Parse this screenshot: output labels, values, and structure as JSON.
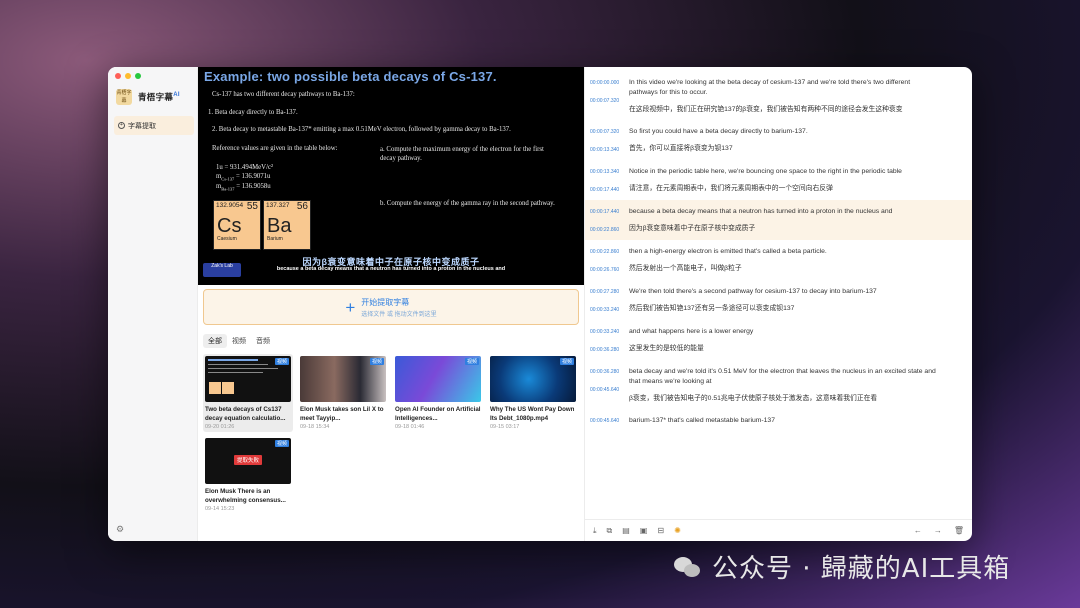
{
  "colors": {
    "accent": "#2f7fe0",
    "highlight": "#fcf3e6",
    "nav_active": "#faeedd",
    "timestamp": "#3a7fd0"
  },
  "app": {
    "name": "青梧字幕",
    "name_sup": "AI",
    "logo_text": "青梧字幕"
  },
  "sidebar": {
    "items": [
      {
        "label": "字幕提取",
        "icon": "plus-circle-icon"
      }
    ],
    "settings_icon": "gear-icon"
  },
  "video": {
    "title": "Example:  two possible beta decays of Cs-137.",
    "intro": "Cs-137 has two different decay pathways to Ba-137:",
    "item1": "1.   Beta decay directly to Ba-137.",
    "item2": "2.   Beta decay to metastable Ba-137* emitting a max 0.51MeV electron, followed by gamma decay to Ba-137.",
    "ref": "Reference values are given in the table below:",
    "qa": "a.   Compute the maximum energy of the electron for the first decay pathway.",
    "qb": "b.   Compute the energy of the gamma ray in the second pathway.",
    "v1": "1u = 931.494MeV/c²",
    "v2": "m",
    "v2s": "Cs-137",
    "v2v": " = 136.9071u",
    "v3": "m",
    "v3s": "Ba-137",
    "v3v": " = 136.9058u",
    "cs": {
      "mass": "132.9054",
      "num": "55",
      "sym": "Cs",
      "name": "Caesium"
    },
    "ba": {
      "mass": "137.327",
      "num": "56",
      "sym": "Ba",
      "name": "Barium"
    },
    "channel": "Zak's Lab",
    "subtitle_zh": "因为β衰变意味着中子在原子核中变成质子",
    "subtitle_en": "because a beta decay means that a neutron has turned into a proton in the nucleus and"
  },
  "upload": {
    "title": "开始提取字幕",
    "hint": "选择文件 或 拖动文件到这里"
  },
  "tabs": [
    {
      "label": "全部"
    },
    {
      "label": "视频"
    },
    {
      "label": "音频"
    }
  ],
  "media": [
    {
      "title": "Two beta decays of Cs137 decay equation calculatio...",
      "date": "09-20 01:26",
      "badge": "视频"
    },
    {
      "title": "Elon Musk takes son Lil X to meet Tayyip...",
      "date": "09-18 15:34",
      "badge": "视频"
    },
    {
      "title": "Open AI Founder on Artificial Intelligences...",
      "date": "09-18 01:46",
      "badge": "视频"
    },
    {
      "title": "Why The US Wont Pay Down Its Debt_1080p.mp4",
      "date": "09-15 03:17",
      "badge": "视频"
    },
    {
      "title": "Elon Musk There is an overwhelming consensus...",
      "date": "09-14 15:23",
      "badge": "视频",
      "status": "提取失败"
    }
  ],
  "subtitles": [
    {
      "start": "00:00:00.000",
      "end": "00:00:07.320",
      "en": "In this video we're looking at the beta decay of cesium-137 and we're told there's two different pathways for this to occur.",
      "zh": "在这段视频中，我们正在研究铯137的β衰变，我们被告知有两种不同的途径会发生这种衰变"
    },
    {
      "start": "00:00:07.320",
      "end": "00:00:13.340",
      "en": "So first you could have a beta decay directly to barium-137.",
      "zh": "首先，你可以直接将β衰变为钡137"
    },
    {
      "start": "00:00:13.340",
      "end": "00:00:17.440",
      "en": "Notice in the periodic table here, we're bouncing one space to the right in the periodic table",
      "zh": "请注意，在元素周期表中，我们将元素周期表中的一个空间向右反弹"
    },
    {
      "start": "00:00:17.440",
      "end": "00:00:22.860",
      "en": "because a beta decay means that a neutron has turned into a proton in the nucleus and",
      "zh": "因为β衰变意味着中子在原子核中变成质子",
      "highlight": true
    },
    {
      "start": "00:00:22.860",
      "end": "00:00:26.760",
      "en": "then a high-energy electron is emitted that's called a beta particle.",
      "zh": "然后发射出一个高能电子，叫做β粒子"
    },
    {
      "start": "00:00:27.280",
      "end": "00:00:33.240",
      "en": "We're then told there's a second pathway for cesium-137 to decay into barium-137",
      "zh": "然后我们被告知铯137还有另一条途径可以衰变成钡137"
    },
    {
      "start": "00:00:33.240",
      "end": "00:00:36.280",
      "en": "and what happens here is a lower energy",
      "zh": "这里发生的是较低的能量"
    },
    {
      "start": "00:00:36.280",
      "end": "00:00:45.640",
      "en": "beta decay and we're told it's 0.51 MeV for the electron that leaves the nucleus in an excited state and that means we're looking at",
      "zh": "β衰变，我们被告知电子的0.51兆电子伏使原子核处于激发态，这意味着我们正在看"
    },
    {
      "start": "00:00:45.640",
      "end": "",
      "en": "barium-137* that's called metastable barium-137",
      "zh": ""
    }
  ],
  "watermark": "公众号 · 歸藏的AI工具箱"
}
